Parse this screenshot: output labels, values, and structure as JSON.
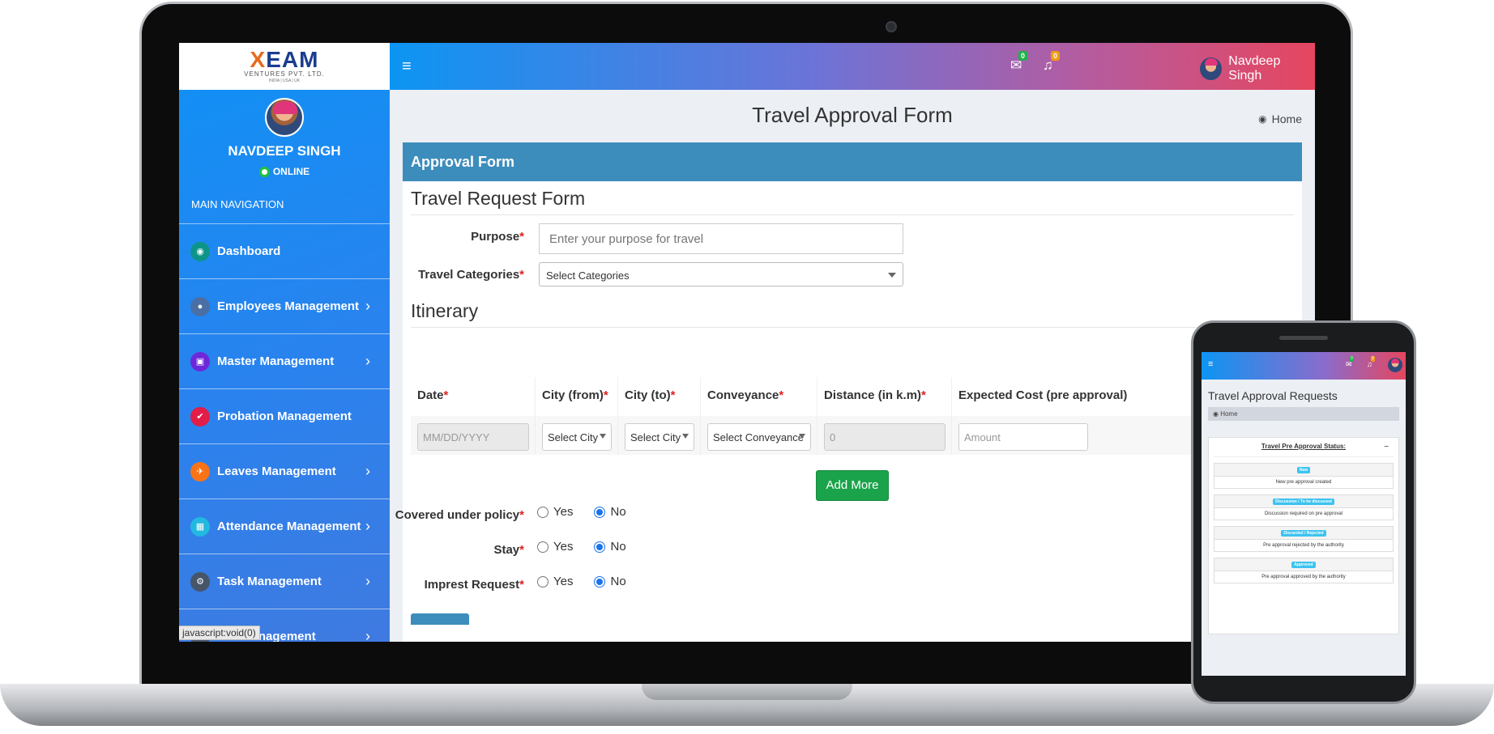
{
  "brand": {
    "logo_main": "XEAM",
    "logo_sub": "VENTURES PVT. LTD.",
    "logo_tiny": "INDIA | USA | UK"
  },
  "user": {
    "name_upper": "NAVDEEP SINGH",
    "name": "Navdeep Singh",
    "status": "ONLINE"
  },
  "topbar": {
    "mail_count": "0",
    "bell_count": "0"
  },
  "sidebar": {
    "heading": "MAIN NAVIGATION",
    "items": [
      {
        "label": "Dashboard",
        "icon": "dashboard-icon",
        "color": "#0d9488",
        "chevron": ""
      },
      {
        "label": "Employees Management",
        "icon": "users-icon",
        "color": "#4a6fa5",
        "chevron": "›"
      },
      {
        "label": "Master Management",
        "icon": "sitemap-icon",
        "color": "#6d28d9",
        "chevron": "›"
      },
      {
        "label": "Probation Management",
        "icon": "check-square-icon",
        "color": "#e11d48",
        "chevron": ""
      },
      {
        "label": "Leaves Management",
        "icon": "plane-icon",
        "color": "#f97316",
        "chevron": "›"
      },
      {
        "label": "Attendance Management",
        "icon": "calendar-icon",
        "color": "#22b8e0",
        "chevron": "›"
      },
      {
        "label": "Task Management",
        "icon": "gear-icon",
        "color": "#475569",
        "chevron": "›"
      }
    ],
    "partial_item": "Management",
    "partial_chevron": "›",
    "status_tip": "javascript:void(0)"
  },
  "page": {
    "title": "Travel Approval Form",
    "breadcrumb": "Home",
    "card_title": "Approval Form",
    "section_request": "Travel Request Form",
    "section_itinerary": "Itinerary"
  },
  "form": {
    "purpose_label": "Purpose",
    "purpose_placeholder": "Enter your purpose for travel",
    "categories_label": "Travel Categories",
    "categories_value": "Select Categories",
    "required_mark": "*"
  },
  "itinerary": {
    "columns": [
      "Date",
      "City (from)",
      "City (to)",
      "Conveyance",
      "Distance (in k.m)",
      "Expected Cost (pre approval)"
    ],
    "row": {
      "date": "MM/DD/YYYY",
      "city_from": "Select City",
      "city_to": "Select City",
      "conveyance": "Select Conveyance",
      "distance": "0",
      "cost": "Amount"
    },
    "add_more": "Add More"
  },
  "options": {
    "yes": "Yes",
    "no": "No",
    "questions": [
      {
        "label": "Covered under policy",
        "selected": "No"
      },
      {
        "label": "Stay",
        "selected": "No"
      },
      {
        "label": "Imprest Request",
        "selected": "No"
      }
    ]
  },
  "mobile": {
    "title": "Travel Approval Requests",
    "breadcrumb": "Home",
    "mail_count": "0",
    "bell_count": "0",
    "status_title": "Travel Pre Approval Status:",
    "statuses": [
      {
        "tag": "New",
        "text": "New pre approval created"
      },
      {
        "tag": "Discussion / To be discussed",
        "text": "Discussion required on pre approval"
      },
      {
        "tag": "Discarded / Rejected",
        "text": "Pre approval rejected by the authority"
      },
      {
        "tag": "Approved",
        "text": "Pre approval approved by the authority"
      }
    ]
  }
}
